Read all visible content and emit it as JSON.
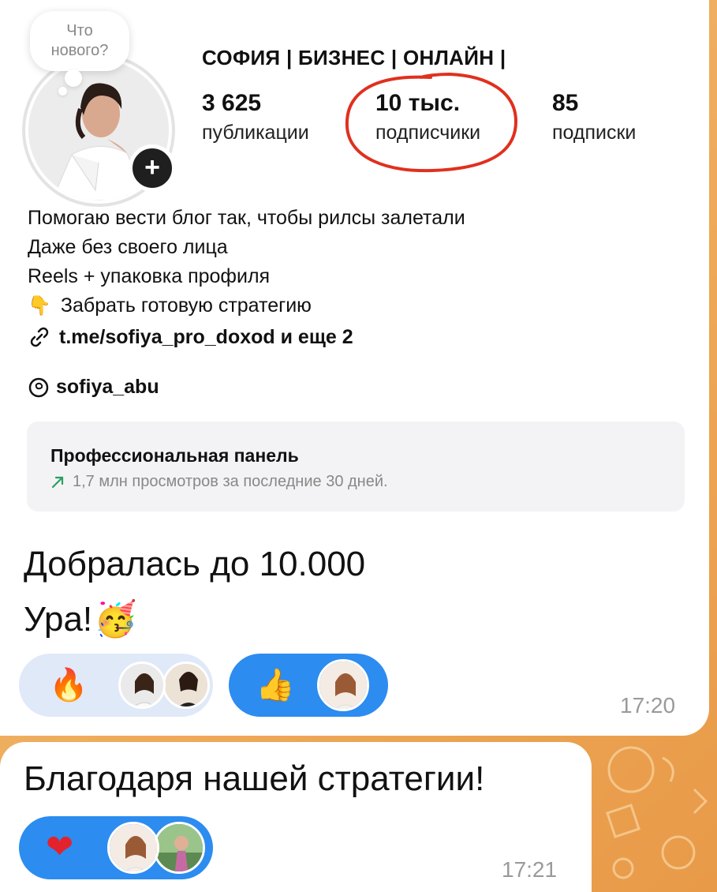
{
  "profile": {
    "note_text_line1": "Что",
    "note_text_line2": "нового?",
    "name": "СОФИЯ | БИЗНЕС | ОНЛАЙН |",
    "stats": [
      {
        "value": "3 625",
        "label": "публикации"
      },
      {
        "value": "10 тыс.",
        "label": "подписчики"
      },
      {
        "value": "85",
        "label": "подписки"
      }
    ],
    "bio_lines": [
      "Помогаю вести блог так, чтобы рилсы залетали",
      "Даже без своего лица",
      "Reels + упаковка профиля",
      "Забрать готовую стратегию"
    ],
    "link_text": "t.me/sofiya_pro_doxod и еще 2",
    "threads_handle": "sofiya_abu",
    "panel_title": "Профессиональная панель",
    "panel_subtitle": "1,7 млн просмотров за последние 30 дней."
  },
  "message1": {
    "line1": "Добралась до 10.000",
    "line2": "Ура!",
    "time": "17:20",
    "reactions": [
      {
        "emoji": "fire",
        "style": "light"
      },
      {
        "emoji": "thumbs-up",
        "style": "blue"
      }
    ]
  },
  "message2": {
    "text": "Благодаря нашей стратегии!",
    "time": "17:21",
    "reactions": [
      {
        "emoji": "heart",
        "style": "blue"
      }
    ]
  },
  "colors": {
    "reaction_blue": "#2c8cf0",
    "reaction_light": "#dfe9f8",
    "highlight_circle": "#e0301e",
    "chat_background": "#eeaa5a"
  }
}
